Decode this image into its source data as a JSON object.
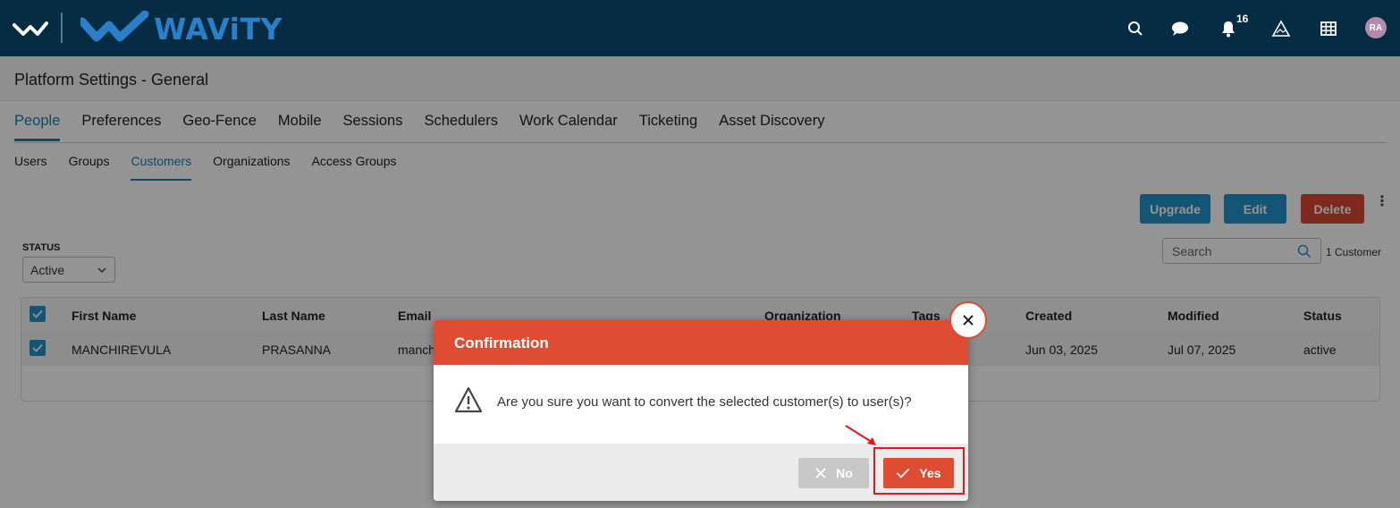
{
  "brand": {
    "name": "WAViTY"
  },
  "topbar": {
    "notification_count": "16",
    "avatar_initials": "RA",
    "icons": [
      "search-icon",
      "chat-icon",
      "bell-icon",
      "alert-triangle-icon",
      "grid-icon"
    ]
  },
  "page": {
    "title": "Platform Settings - General"
  },
  "tabs": [
    {
      "label": "People",
      "active": true
    },
    {
      "label": "Preferences"
    },
    {
      "label": "Geo-Fence"
    },
    {
      "label": "Mobile"
    },
    {
      "label": "Sessions"
    },
    {
      "label": "Schedulers"
    },
    {
      "label": "Work Calendar"
    },
    {
      "label": "Ticketing"
    },
    {
      "label": "Asset Discovery"
    }
  ],
  "subtabs": [
    {
      "label": "Users"
    },
    {
      "label": "Groups"
    },
    {
      "label": "Customers",
      "active": true
    },
    {
      "label": "Organizations"
    },
    {
      "label": "Access Groups"
    }
  ],
  "actions": {
    "upgrade": "Upgrade",
    "edit": "Edit",
    "delete": "Delete"
  },
  "filter": {
    "status_label": "STATUS",
    "status_value": "Active"
  },
  "search": {
    "placeholder": "Search",
    "count_text": "1 Customer"
  },
  "table": {
    "columns": [
      "First Name",
      "Last Name",
      "Email",
      "Organization",
      "Tags",
      "Created",
      "Modified",
      "Status"
    ],
    "rows": [
      {
        "first_name": "MANCHIREVULA",
        "last_name": "PRASANNA",
        "email": "manch",
        "created": "Jun 03, 2025",
        "modified": "Jul 07, 2025",
        "status": "active"
      }
    ]
  },
  "modal": {
    "title": "Confirmation",
    "message": "Are you sure you want to convert the selected customer(s) to user(s)?",
    "no_label": "No",
    "yes_label": "Yes"
  },
  "colors": {
    "topbar": "#062c43",
    "accent": "#2391c9",
    "danger": "#de4c33"
  }
}
